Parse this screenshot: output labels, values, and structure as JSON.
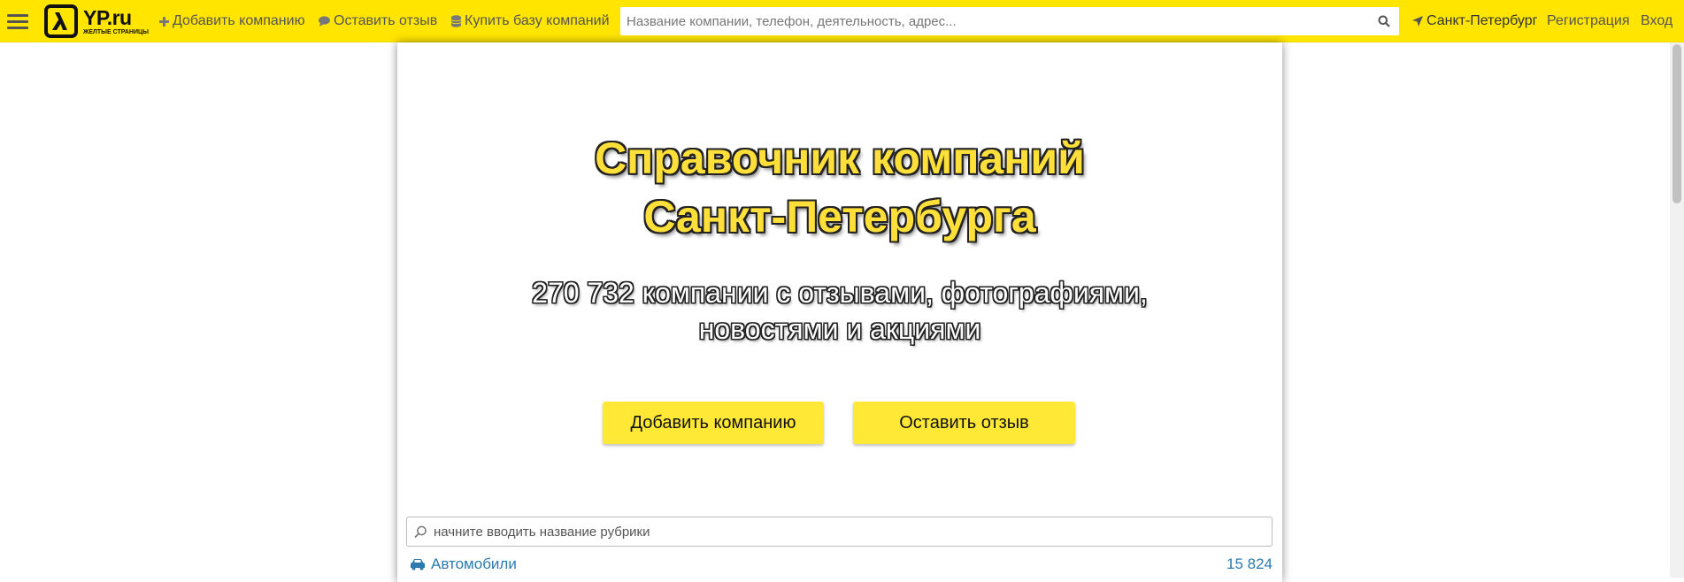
{
  "header": {
    "logo": {
      "text": "YP.ru",
      "subtitle": "ЖЕЛТЫЕ СТРАНИЦЫ",
      "icon": "yellow-pages-logo-icon"
    },
    "nav": {
      "add_company": {
        "label": "Добавить компанию",
        "icon": "plus-icon"
      },
      "leave_review": {
        "label": "Оставить отзыв",
        "icon": "speech-bubble-icon"
      },
      "buy_database": {
        "label": "Купить базу компаний",
        "icon": "database-icon"
      }
    },
    "search": {
      "placeholder": "Название компании, телефон, деятельность, адрес...",
      "value": ""
    },
    "city": {
      "label": "Санкт-Петербург",
      "icon": "location-arrow-icon"
    },
    "register": "Регистрация",
    "login": "Вход"
  },
  "hero": {
    "title_line1": "Справочник компаний",
    "title_line2": "Санкт-Петербурга",
    "subtitle_line1": "270 732 компании с отзывами, фотографиями,",
    "subtitle_line2": "новостями и акциями"
  },
  "actions": {
    "add_company": "Добавить компанию",
    "leave_review": "Оставить отзыв"
  },
  "rubric_search": {
    "placeholder": "начните вводить название рубрики",
    "value": ""
  },
  "categories": [
    {
      "label": "Автомобили",
      "count": "15 824",
      "icon": "car-icon"
    }
  ],
  "colors": {
    "brand_yellow": "#ffe500",
    "button_yellow": "#ffe836",
    "link_blue": "#2a7ab0",
    "nav_text": "#555555"
  }
}
